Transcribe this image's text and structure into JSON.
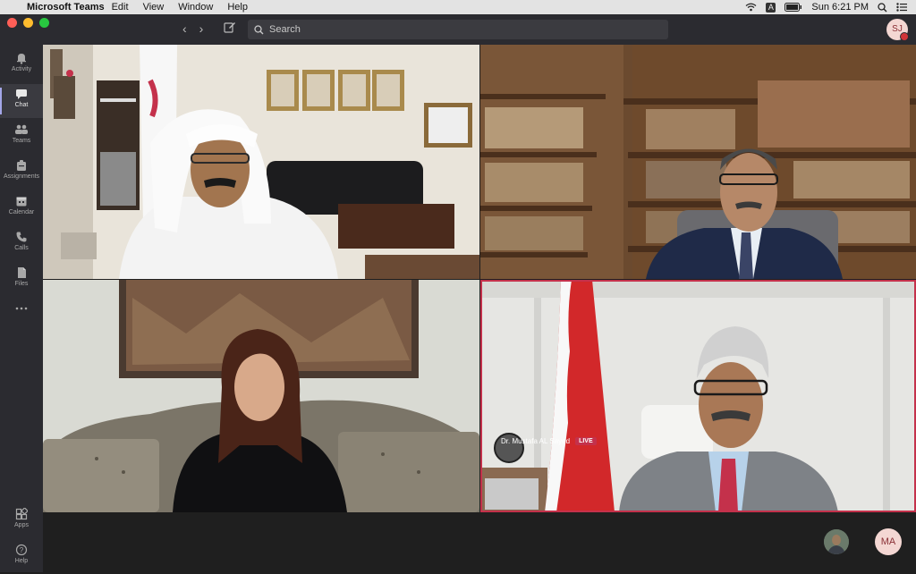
{
  "menubar": {
    "app_name": "Microsoft Teams",
    "items": [
      "Edit",
      "View",
      "Window",
      "Help"
    ],
    "clock": "Sun 6:21 PM",
    "input_badge": "A"
  },
  "titlebar": {
    "search_placeholder": "Search",
    "user_initials": "SJ"
  },
  "rail": {
    "items": [
      {
        "label": "Activity",
        "icon": "bell-icon"
      },
      {
        "label": "Chat",
        "icon": "chat-icon",
        "active": true
      },
      {
        "label": "Teams",
        "icon": "teams-icon"
      },
      {
        "label": "Assignments",
        "icon": "assignments-icon"
      },
      {
        "label": "Calendar",
        "icon": "calendar-icon"
      },
      {
        "label": "Calls",
        "icon": "phone-icon"
      },
      {
        "label": "Files",
        "icon": "files-icon"
      },
      {
        "label": "",
        "icon": "more-icon"
      }
    ],
    "bottom": [
      {
        "label": "Apps",
        "icon": "apps-icon"
      },
      {
        "label": "Help",
        "icon": "help-icon"
      }
    ]
  },
  "call": {
    "speaker_name": "Dr. Mustafa AL Sayed",
    "live_badge": "LIVE",
    "participant_initials": "MA"
  },
  "colors": {
    "accent": "#a4a6e8",
    "live": "#c4314b",
    "speaking_border": "#c4314b"
  }
}
